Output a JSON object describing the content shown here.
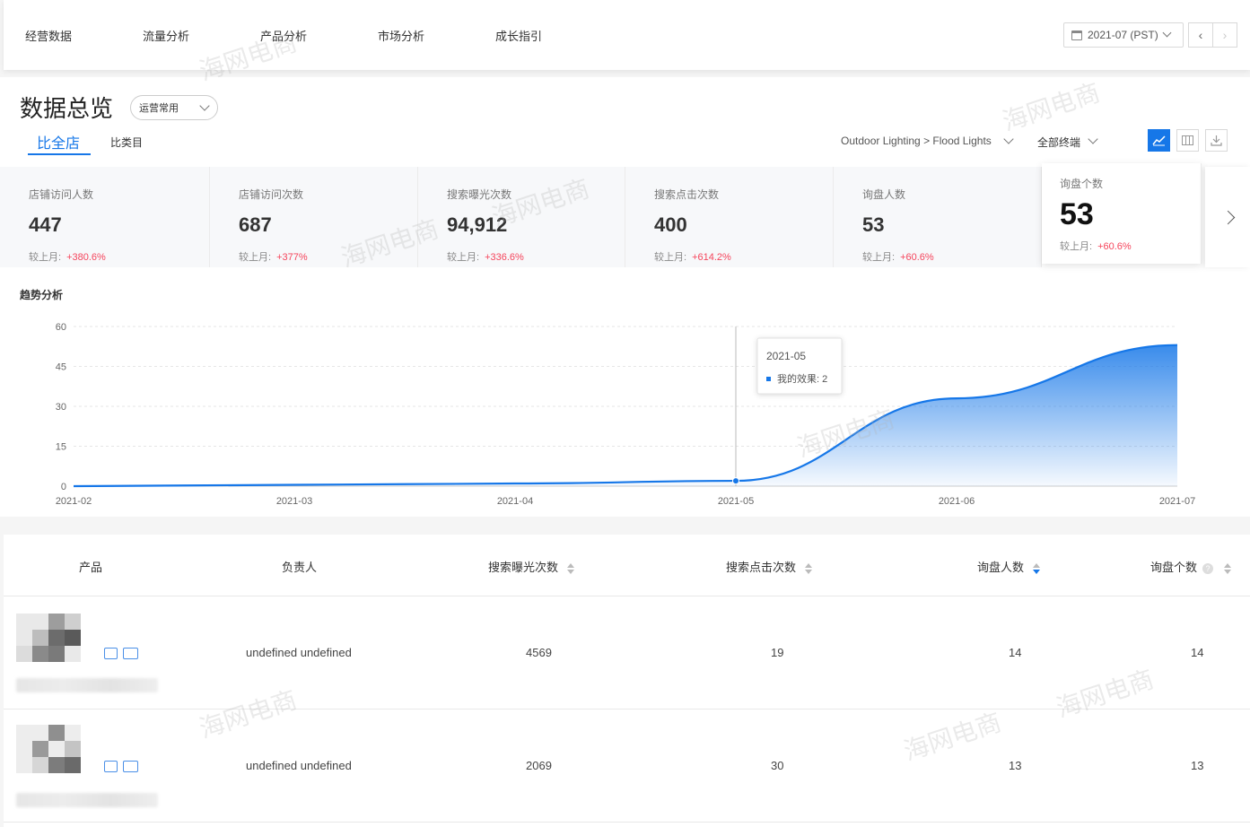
{
  "nav": {
    "items": [
      "经营数据",
      "流量分析",
      "产品分析",
      "市场分析",
      "成长指引"
    ],
    "date_value": "2021-07 (PST)"
  },
  "header": {
    "title": "数据总览",
    "preset": "运营常用",
    "tabs": [
      "比全店",
      "比类目"
    ],
    "category_filter": "Outdoor Lighting > Flood Lights",
    "terminal_filter": "全部终端"
  },
  "metrics": [
    {
      "label": "店铺访问人数",
      "value": "447",
      "cmp_label": "较上月:",
      "change": "+380.6%"
    },
    {
      "label": "店铺访问次数",
      "value": "687",
      "cmp_label": "较上月:",
      "change": "+377%"
    },
    {
      "label": "搜索曝光次数",
      "value": "94,912",
      "cmp_label": "较上月:",
      "change": "+336.6%"
    },
    {
      "label": "搜索点击次数",
      "value": "400",
      "cmp_label": "较上月:",
      "change": "+614.2%"
    },
    {
      "label": "询盘人数",
      "value": "53",
      "cmp_label": "较上月:",
      "change": "+60.6%"
    },
    {
      "label": "询盘个数",
      "value": "53",
      "cmp_label": "较上月:",
      "change": "+60.6%"
    }
  ],
  "trend": {
    "title": "趋势分析",
    "tooltip_date": "2021-05",
    "tooltip_text": "我的效果: 2"
  },
  "chart_data": {
    "type": "area",
    "x": [
      "2021-02",
      "2021-03",
      "2021-04",
      "2021-05",
      "2021-06",
      "2021-07"
    ],
    "series": [
      {
        "name": "我的效果",
        "values": [
          0,
          0.5,
          1,
          2,
          33,
          53
        ]
      }
    ],
    "yticks": [
      0,
      15,
      30,
      45,
      60
    ],
    "ylim": [
      0,
      60
    ],
    "grid": true,
    "color": "#1677e8"
  },
  "table": {
    "headers": [
      "产品",
      "负责人",
      "搜索曝光次数",
      "搜索点击次数",
      "询盘人数",
      "询盘个数"
    ],
    "rows": [
      {
        "owner": "undefined undefined",
        "exposure": "4569",
        "clicks": "19",
        "inquirers": "14",
        "inquiries": "14"
      },
      {
        "owner": "undefined undefined",
        "exposure": "2069",
        "clicks": "30",
        "inquirers": "13",
        "inquiries": "13"
      }
    ]
  },
  "watermark": "海网电商",
  "colors": {
    "accent": "#1677e8",
    "positive_change": "#f5455c"
  }
}
